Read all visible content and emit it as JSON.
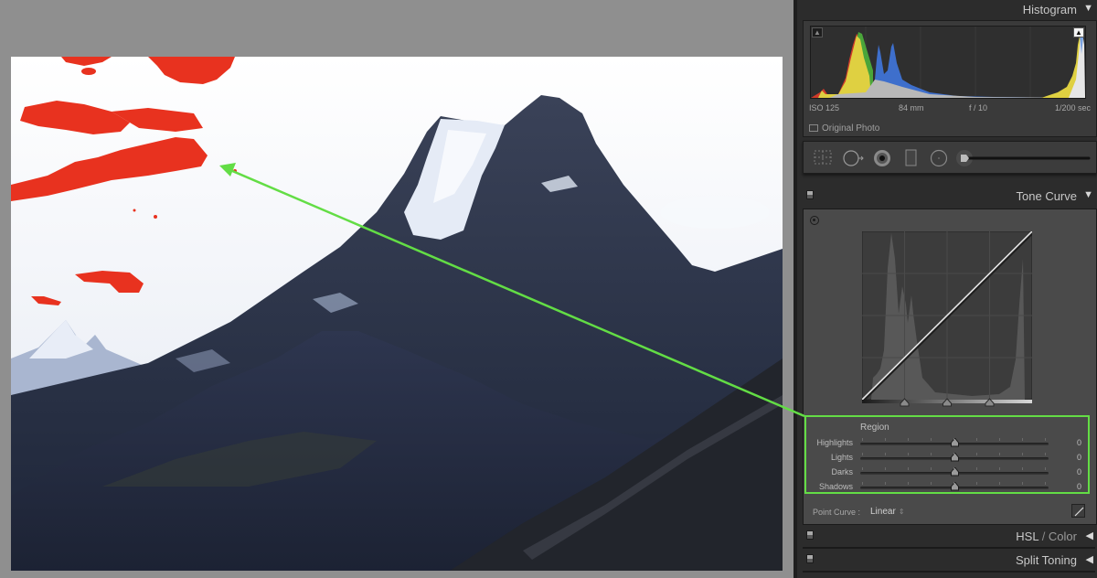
{
  "photo": {
    "description": "Mountain landscape with clipped highlights shown in red",
    "clipping_overlay_color": "#e8321f"
  },
  "panel": {
    "histogram": {
      "title": "Histogram",
      "collapse_icon": "triangle-down-icon",
      "exif": {
        "iso": "ISO 125",
        "focal_length": "84 mm",
        "aperture": "f / 10",
        "shutter": "1/200 sec"
      },
      "original_photo_label": "Original Photo",
      "shadow_clip_icon": "triangle-up-icon",
      "highlight_clip_icon": "triangle-up-icon",
      "highlight_clipping_on": true
    },
    "tools": [
      {
        "name": "crop-overlay-icon"
      },
      {
        "name": "spot-removal-icon"
      },
      {
        "name": "red-eye-icon"
      },
      {
        "name": "graduated-filter-icon"
      },
      {
        "name": "radial-filter-icon"
      },
      {
        "name": "adjustment-brush-slider"
      }
    ],
    "tone_curve": {
      "title": "Tone Curve",
      "collapse_icon": "triangle-down-icon",
      "region_label": "Region",
      "sliders": [
        {
          "label": "Highlights",
          "value": "0",
          "position": 0.5
        },
        {
          "label": "Lights",
          "value": "0",
          "position": 0.5
        },
        {
          "label": "Darks",
          "value": "0",
          "position": 0.5
        },
        {
          "label": "Shadows",
          "value": "0",
          "position": 0.5
        }
      ],
      "split_points": [
        0.25,
        0.5,
        0.75
      ],
      "point_curve_label": "Point Curve :",
      "point_curve_value": "Linear",
      "point_curve_updown": "⇕"
    },
    "hsl": {
      "title_main": "HSL",
      "title_sep": " / ",
      "title_alt": "Color",
      "expand_icon": "triangle-left-icon"
    },
    "split_toning": {
      "title": "Split Toning",
      "expand_icon": "triangle-left-icon"
    },
    "glyphs": {
      "tri_down": "▼",
      "tri_left": "◀",
      "tri_up": "▲"
    }
  },
  "annotation": {
    "color": "#63dd45",
    "arrow_from": "region-sliders",
    "arrow_to": "clipped-sky"
  }
}
